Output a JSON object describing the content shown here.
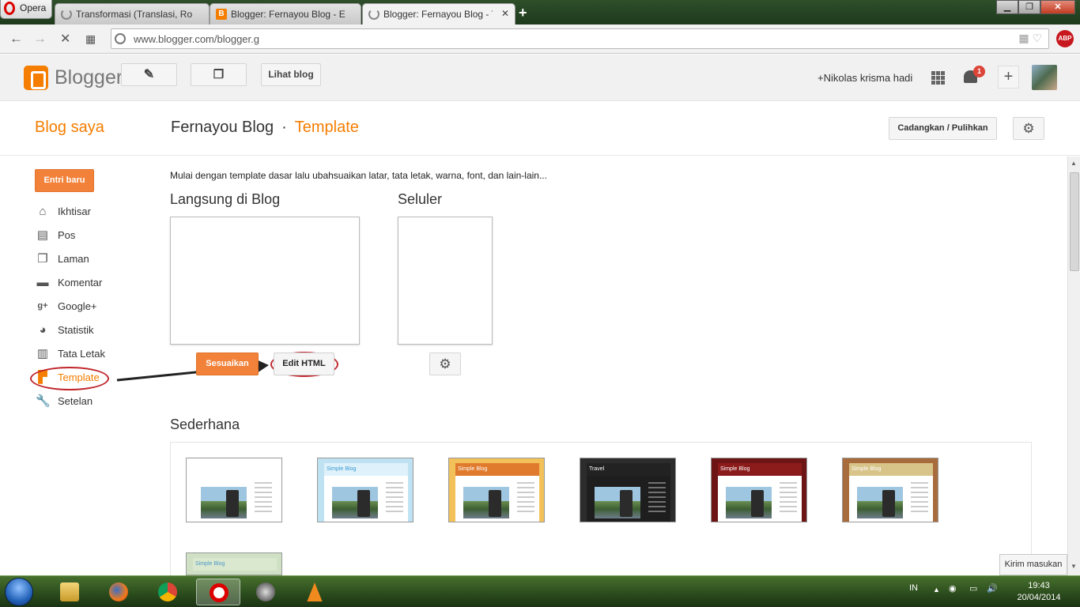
{
  "browser": {
    "menu_label": "Opera",
    "tabs": [
      {
        "label": "Transformasi (Translasi, Ro",
        "icon": "loading-spinner-icon"
      },
      {
        "label": "Blogger: Fernayou Blog - E",
        "icon": "blogger-icon"
      },
      {
        "label": "Blogger: Fernayou Blog - T",
        "icon": "loading-spinner-icon"
      }
    ],
    "new_tab": "+",
    "url": "www.blogger.com/blogger.g",
    "adblock_label": "ABP"
  },
  "header": {
    "brand": "Blogger",
    "view_blog_label": "Lihat blog",
    "user_name": "+Nikolas krisma hadi",
    "notification_count": "1"
  },
  "page_header": {
    "my_blogs": "Blog saya",
    "blog_name": "Fernayou Blog",
    "separator": "·",
    "section": "Template",
    "backup_label": "Cadangkan / Pulihkan"
  },
  "sidebar": {
    "new_post_label": "Entri baru",
    "items": [
      {
        "label": "Ikhtisar",
        "icon": "home-icon"
      },
      {
        "label": "Pos",
        "icon": "posts-icon"
      },
      {
        "label": "Laman",
        "icon": "page-icon"
      },
      {
        "label": "Komentar",
        "icon": "comment-icon"
      },
      {
        "label": "Google+",
        "icon": "google-plus-icon"
      },
      {
        "label": "Statistik",
        "icon": "pie-chart-icon"
      },
      {
        "label": "Tata Letak",
        "icon": "layout-icon"
      },
      {
        "label": "Template",
        "icon": "paint-roller-icon",
        "active": true
      },
      {
        "label": "Setelan",
        "icon": "wrench-icon"
      }
    ]
  },
  "main": {
    "intro": "Mulai dengan template dasar lalu ubahsuaikan latar, tata letak, warna, font, dan lain-lain...",
    "live_heading": "Langsung di Blog",
    "mobile_heading": "Seluler",
    "customize_label": "Sesuaikan",
    "edit_html_label": "Edit HTML",
    "simple_heading": "Sederhana",
    "themes": [
      {
        "title": "",
        "bar": "#ffffff",
        "bg": "#ffffff",
        "text": "#333333"
      },
      {
        "title": "Simple Blog",
        "bar": "#dff1fa",
        "bg": "#bfe2f2",
        "text": "#3a9bd1"
      },
      {
        "title": "Simple Blog",
        "bar": "#e07a2c",
        "bg": "#f2c15a",
        "text": "#ffffff"
      },
      {
        "title": "Travel",
        "bar": "#222222",
        "bg": "#2c2c2c",
        "text": "#ffffff"
      },
      {
        "title": "Simple Blog",
        "bar": "#8c1c1c",
        "bg": "#6d1414",
        "text": "#ffffff"
      },
      {
        "title": "Simple Blog",
        "bar": "#d8c489",
        "bg": "#a86b3c",
        "text": "#ffffff"
      },
      {
        "title": "Simple Blog",
        "bar": "#d9e8cf",
        "bg": "#cfe0c4",
        "text": "#4e9ac9"
      }
    ],
    "feedback_label": "Kirim masukan"
  },
  "taskbar": {
    "language": "IN",
    "time": "19:43",
    "date": "20/04/2014"
  },
  "colors": {
    "accent": "#f57d00",
    "button_orange": "#f2823a",
    "annotation_red": "#c0262c"
  }
}
